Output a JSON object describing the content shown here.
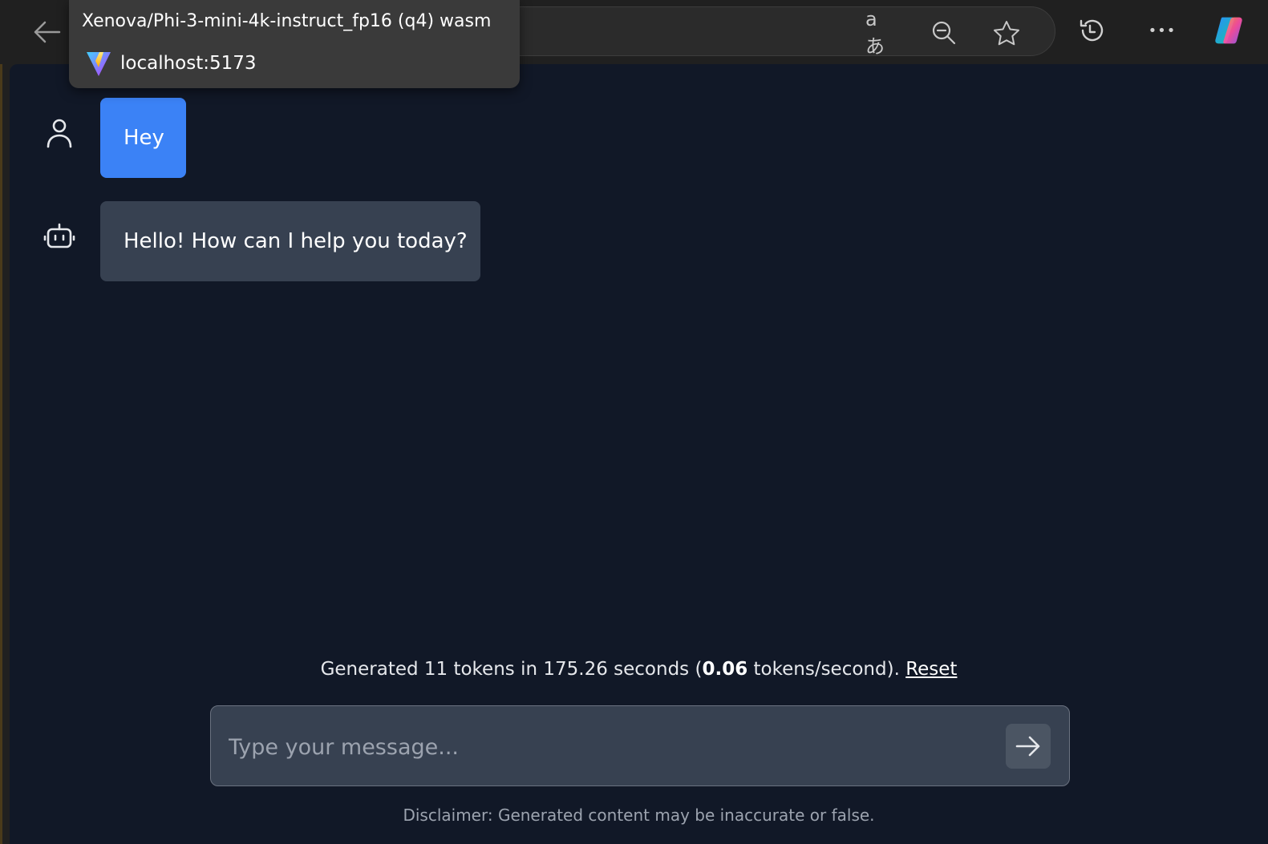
{
  "browser": {
    "tooltip": {
      "title": "Xenova/Phi-3-mini-4k-instruct_fp16 (q4) wasm",
      "url": "localhost:5173"
    },
    "toolbar_icons": [
      "back-arrow-icon",
      "translate-icon",
      "zoom-out-icon",
      "favorite-star-icon",
      "history-icon",
      "more-options-icon",
      "copilot-icon"
    ],
    "translate_glyph": "aあ",
    "more_glyph": "•••"
  },
  "chat": {
    "messages": [
      {
        "role": "user",
        "text": "Hey"
      },
      {
        "role": "assistant",
        "text": "Hello! How can I help you today?"
      }
    ]
  },
  "stats": {
    "prefix": "Generated 11 tokens in 175.26 seconds (",
    "rate": "0.06",
    "suffix": " tokens/second).",
    "reset_label": "Reset"
  },
  "input": {
    "placeholder": "Type your message...",
    "value": ""
  },
  "disclaimer": "Disclaimer: Generated content may be inaccurate or false.",
  "colors": {
    "page_bg": "#111827",
    "user_bubble": "#3b82f6",
    "bot_bubble": "#374151",
    "input_bg": "#374151",
    "send_button": "#4b5563"
  }
}
